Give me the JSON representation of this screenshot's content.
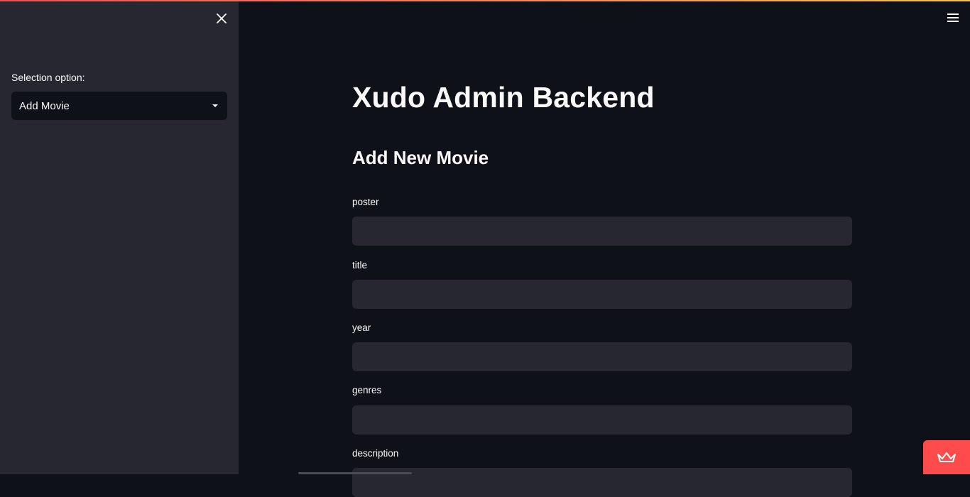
{
  "sidebar": {
    "select_label": "Selection option:",
    "select_value": "Add Movie",
    "close_icon": "close-icon"
  },
  "header": {
    "menu_icon": "hamburger-menu-icon"
  },
  "main": {
    "title": "Xudo Admin Backend",
    "section_title": "Add New Movie",
    "fields": [
      {
        "label": "poster",
        "value": ""
      },
      {
        "label": "title",
        "value": ""
      },
      {
        "label": "year",
        "value": ""
      },
      {
        "label": "genres",
        "value": ""
      },
      {
        "label": "description",
        "value": ""
      }
    ]
  },
  "badge": {
    "icon": "crown-icon"
  },
  "colors": {
    "background": "#0e1117",
    "sidebar": "#262730",
    "input": "#262730",
    "accent": "#ff4b4b"
  }
}
